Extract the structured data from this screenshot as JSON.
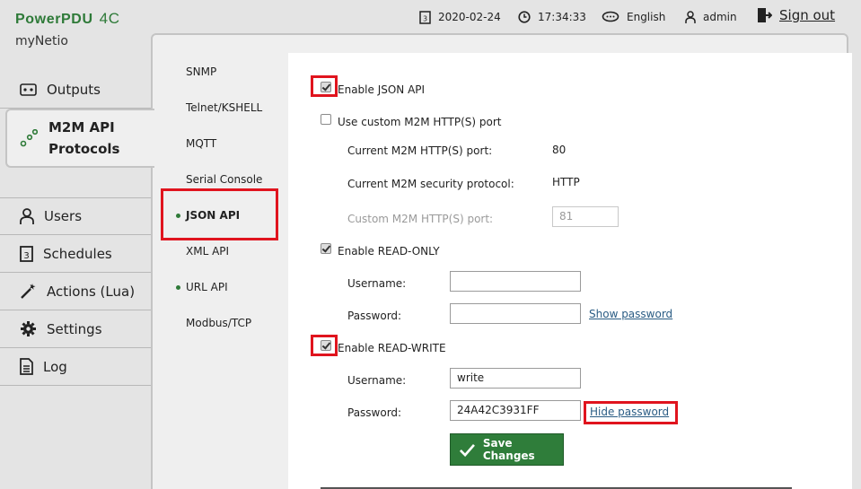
{
  "header": {
    "brand": "PowerPDU",
    "brand_suffix": "4C",
    "device_name": "myNetio",
    "date": "2020-02-24",
    "time": "17:34:33",
    "language": "English",
    "user": "admin",
    "sign_out": "Sign out"
  },
  "nav": {
    "items": [
      {
        "label": "Outputs",
        "icon": "outputs-icon"
      },
      {
        "label": "M2M API\nProtocols",
        "icon": "m2m-icon",
        "active": true
      },
      {
        "label": "Users",
        "icon": "user-icon"
      },
      {
        "label": "Schedules",
        "icon": "calendar-icon"
      },
      {
        "label": "Actions (Lua)",
        "icon": "wand-icon"
      },
      {
        "label": "Settings",
        "icon": "gear-icon"
      },
      {
        "label": "Log",
        "icon": "document-icon"
      }
    ]
  },
  "subnav": {
    "items": [
      {
        "label": "SNMP"
      },
      {
        "label": "Telnet/KSHELL"
      },
      {
        "label": "MQTT"
      },
      {
        "label": "Serial Console"
      },
      {
        "label": "JSON API",
        "active": true,
        "dot": true
      },
      {
        "label": "XML API"
      },
      {
        "label": "URL API",
        "dot": true
      },
      {
        "label": "Modbus/TCP"
      }
    ]
  },
  "form": {
    "enable_json_api": {
      "label": "Enable JSON API",
      "checked": true
    },
    "custom_port": {
      "label": "Use custom M2M HTTP(S) port",
      "checked": false
    },
    "current_port_label": "Current M2M HTTP(S) port:",
    "current_port_value": "80",
    "current_protocol_label": "Current M2M security protocol:",
    "current_protocol_value": "HTTP",
    "custom_port_field_label": "Custom M2M HTTP(S) port:",
    "custom_port_field_value": "81",
    "read_only": {
      "label": "Enable READ-ONLY",
      "checked": true,
      "username_label": "Username:",
      "username_value": "",
      "password_label": "Password:",
      "password_value": "",
      "password_toggle": "Show password"
    },
    "read_write": {
      "label": "Enable READ-WRITE",
      "checked": true,
      "username_label": "Username:",
      "username_value": "write",
      "password_label": "Password:",
      "password_value": "24A42C3931FF",
      "password_toggle": "Hide password"
    },
    "save_label": "Save Changes"
  },
  "colors": {
    "brand": "#2e7a38",
    "button": "#2f7d3a",
    "highlight": "#e0141e",
    "link": "#2a5c84"
  }
}
